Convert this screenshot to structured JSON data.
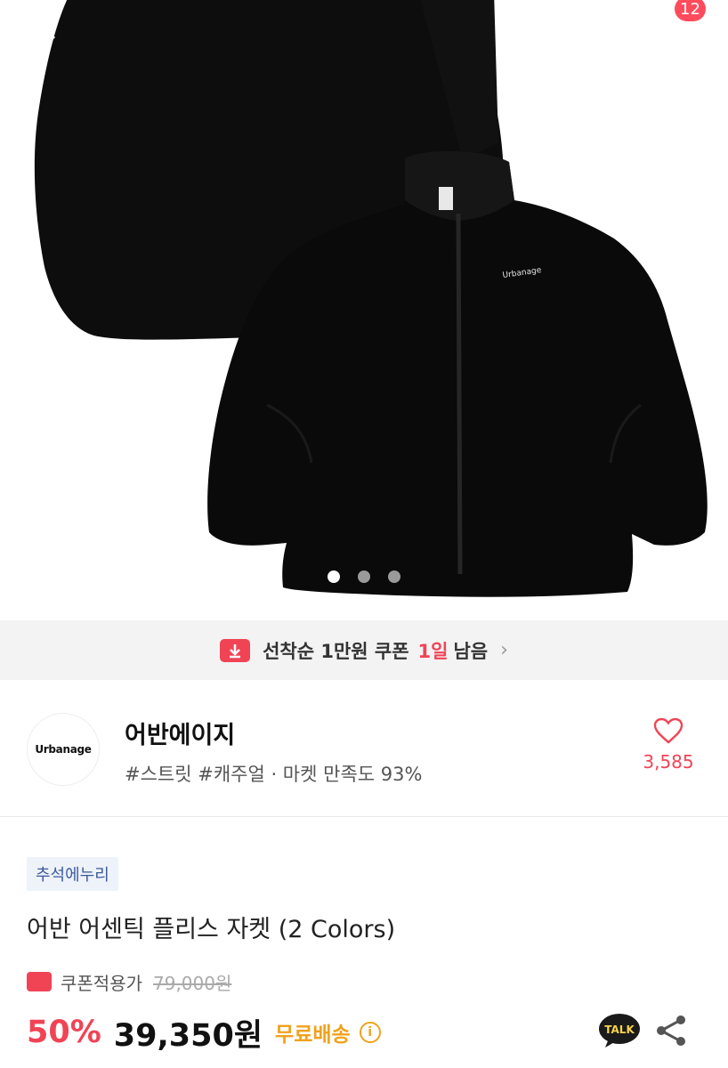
{
  "header": {
    "cart_count": "12",
    "icons": [
      "chevron-left-icon",
      "home-icon",
      "search-icon",
      "cart-icon"
    ]
  },
  "hero": {
    "jacket_logo": "Urbanage",
    "slides": 3,
    "active_slide": 1
  },
  "coupon_banner": {
    "label": "선착순 1만원 쿠폰",
    "highlight": "1일",
    "suffix": "남음"
  },
  "brand": {
    "logo_text": "Urbanage",
    "name": "어반에이지",
    "tags": "#스트릿 #캐주얼 · 마켓 만족도 93%",
    "likes": "3,585"
  },
  "product": {
    "event_badge": "추석에누리",
    "title": "어반 어센틱 플리스 자켓 (2 Colors)",
    "coupon_label": "쿠폰적용가",
    "original_price": "79,000원",
    "discount": "50%",
    "price": "39,350원",
    "shipping": "무료배송",
    "talk_label": "TALK"
  },
  "colors": {
    "accent": "#f04455",
    "shipping": "#f0a21c",
    "badge_bg": "#eef2f9",
    "badge_text": "#3b5a9b"
  }
}
